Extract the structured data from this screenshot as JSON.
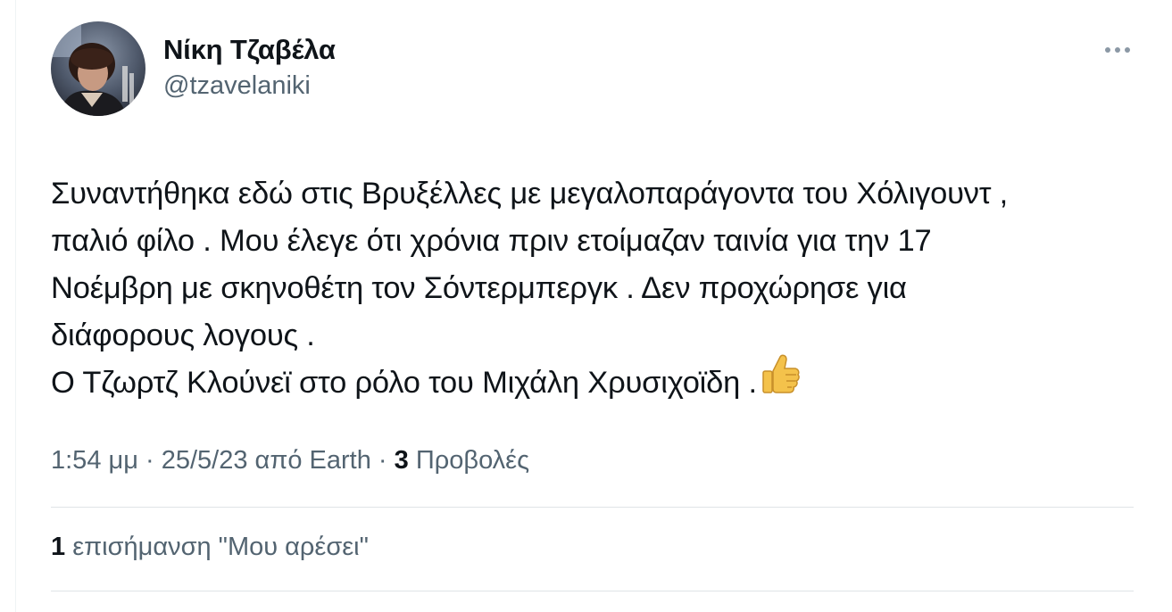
{
  "author": {
    "display_name": "Νίκη Τζαβέλα",
    "handle": "@tzavelaniki"
  },
  "tweet": {
    "lines": [
      "Συναντήθηκα εδώ στις Βρυξέλλες με μεγαλοπαράγοντα του Χόλιγουντ ,",
      "παλιό φίλο . Μου έλεγε ότι χρόνια πριν ετοίμαζαν ταινία για την 17",
      "Νοέμβρη με σκηνοθέτη τον Σόντερμπεργκ . Δεν προχώρησε για",
      "διάφορους λογους .",
      "Ο Τζωρτζ Κλούνεϊ στο ρόλο του Μιχάλη Χρυσιχοϊδη ."
    ],
    "emoji": "thumbs-up-icon"
  },
  "meta": {
    "time": "1:54 μμ",
    "separator": "·",
    "date": "25/5/23",
    "source_prefix": "από",
    "source": "Earth",
    "views_count": "3",
    "views_label": "Προβολές"
  },
  "likes": {
    "count": "1",
    "label": "επισήμανση \"Μου αρέσει\""
  },
  "colors": {
    "text_primary": "#0f1419",
    "text_secondary": "#536471",
    "divider": "#dfe4e7"
  }
}
